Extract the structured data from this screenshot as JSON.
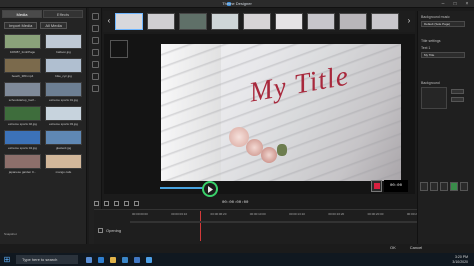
{
  "window": {
    "title": "Theme Designer"
  },
  "media_panel": {
    "tabs": [
      "Media",
      "Effects"
    ],
    "import_button": "Import Media",
    "filter": "All Media",
    "items": [
      {
        "caption": "108387_fonk/Page",
        "color": "#8aa27a"
      },
      {
        "caption": "balloon.jpg",
        "color": "#bfc9d5"
      },
      {
        "caption": "beach_380.mp4",
        "color": "#7b6a4c"
      },
      {
        "caption": "bike_cyc.jpg",
        "color": "#b0bfd0"
      },
      {
        "caption": "schoolstartup_Gelf...",
        "color": "#7f8a99"
      },
      {
        "caption": "extreme sports 01.jpg",
        "color": "#6d7f93"
      },
      {
        "caption": "extreme sports 02.jpg",
        "color": "#3e6d3c"
      },
      {
        "caption": "extreme sports 03.jpg",
        "color": "#c7d3dd"
      },
      {
        "caption": "extreme sports 04.jpg",
        "color": "#3c72b8"
      },
      {
        "caption": "glacierd.jpg",
        "color": "#5f88b4"
      },
      {
        "caption": "japanese garden 0...",
        "color": "#8d6f6b"
      },
      {
        "caption": "mango cafe",
        "color": "#d2b79a"
      }
    ],
    "footer_label": "Snapshot"
  },
  "template_strip": {
    "templates": [
      {
        "color": "#d8d8dc"
      },
      {
        "color": "#d0cfd2"
      },
      {
        "color": "#5f7068"
      },
      {
        "color": "#cfd6d8"
      },
      {
        "color": "#d7d4d6"
      },
      {
        "color": "#e5e3e5"
      },
      {
        "color": "#c7c6cb"
      },
      {
        "color": "#b9b6ba"
      },
      {
        "color": "#c9c7cc"
      }
    ]
  },
  "preview": {
    "title_text": "My Title",
    "timecode": "00:00:00:00"
  },
  "right_panel": {
    "background_music_label": "Background music",
    "music_value": "Default (Sole Page)",
    "title_settings_label": "Title settings",
    "text_label": "Text 1",
    "text_value": "My Title",
    "background_label": "Background",
    "mini_preview_text": "00:00"
  },
  "timeline": {
    "ruler": [
      "00:00:00:00",
      "00:00:03:10",
      "00:00:06:20",
      "00:00:10:00",
      "00:00:13:10",
      "00:00:16:20",
      "00:00:20:00",
      "00:00:23:10",
      "00:00:26:20"
    ],
    "track_label": "Opening"
  },
  "footer": {
    "ok_label": "OK",
    "cancel_label": "Cancel"
  },
  "taskbar": {
    "search_placeholder": "Type here to search",
    "time": "3:20 PM",
    "date": "3/10/2020"
  },
  "colors": {
    "accent": "#48a3e0",
    "handle_ring": "#3ad16b",
    "title_red": "#a8283c"
  }
}
